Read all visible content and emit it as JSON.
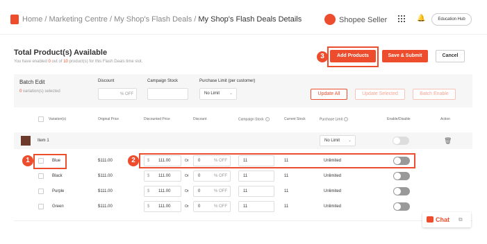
{
  "breadcrumb": {
    "home": "Home",
    "sep": " / ",
    "marketing": "Marketing Centre",
    "deals": "My Shop's Flash Deals",
    "current": "My Shop's Flash Deals Details"
  },
  "header": {
    "seller_label": "Shopee Seller",
    "edu_hub": "Education Hub"
  },
  "section": {
    "title": "Total Product(s) Available",
    "sub_prefix": "You have enabled ",
    "enabled_count": "0",
    "sub_mid": " out of ",
    "total_count": "10",
    "sub_suffix": " product(s) for this Flash Deals time slot."
  },
  "actions": {
    "add_products": "Add Products",
    "save_submit": "Save & Submit",
    "cancel": "Cancel"
  },
  "markers": [
    "1",
    "2",
    "3"
  ],
  "batch": {
    "title": "Batch Edit",
    "selected_count": "0",
    "selected_label": " variation(s) selected",
    "discount_label": "Discount",
    "discount_suffix": "% OFF",
    "stock_label": "Campaign Stock",
    "limit_label": "Purchase Limit (per customer)",
    "limit_value": "No Limit",
    "update_all": "Update All",
    "update_selected": "Update Selected",
    "batch_enable": "Batch Enable"
  },
  "table": {
    "headers": [
      "Variation(s)",
      "Original Price",
      "Discounted Price",
      "Discount",
      "Campaign Stock",
      "Current Stock",
      "Purchase Limit",
      "Enable/Disable",
      "Action"
    ],
    "item_name": "Item 1",
    "item_limit": "No Limit",
    "currency": "$",
    "or": "Or",
    "off": "% OFF",
    "rows": [
      {
        "variation": "Blue",
        "original": "$111.00",
        "discounted": "111.00",
        "discount": "0",
        "stock": "11",
        "current": "11",
        "limit": "Unlimited",
        "enabled": false
      },
      {
        "variation": "Black",
        "original": "$111.00",
        "discounted": "111.00",
        "discount": "0",
        "stock": "11",
        "current": "11",
        "limit": "Unlimited",
        "enabled": false
      },
      {
        "variation": "Purple",
        "original": "$111.00",
        "discounted": "111.00",
        "discount": "0",
        "stock": "11",
        "current": "11",
        "limit": "Unlimited",
        "enabled": false
      },
      {
        "variation": "Green",
        "original": "$111.00",
        "discounted": "111.00",
        "discount": "0",
        "stock": "11",
        "current": "11",
        "limit": "Unlimited",
        "enabled": false
      }
    ]
  },
  "chat": {
    "label": "Chat"
  },
  "colors": {
    "brand": "#ee4d2d"
  },
  "icons": [
    "shopee-bag-icon",
    "apps-grid-icon",
    "bell-icon",
    "info-icon",
    "chevron-down-icon",
    "trash-icon",
    "chat-icon",
    "minimize-icon"
  ]
}
